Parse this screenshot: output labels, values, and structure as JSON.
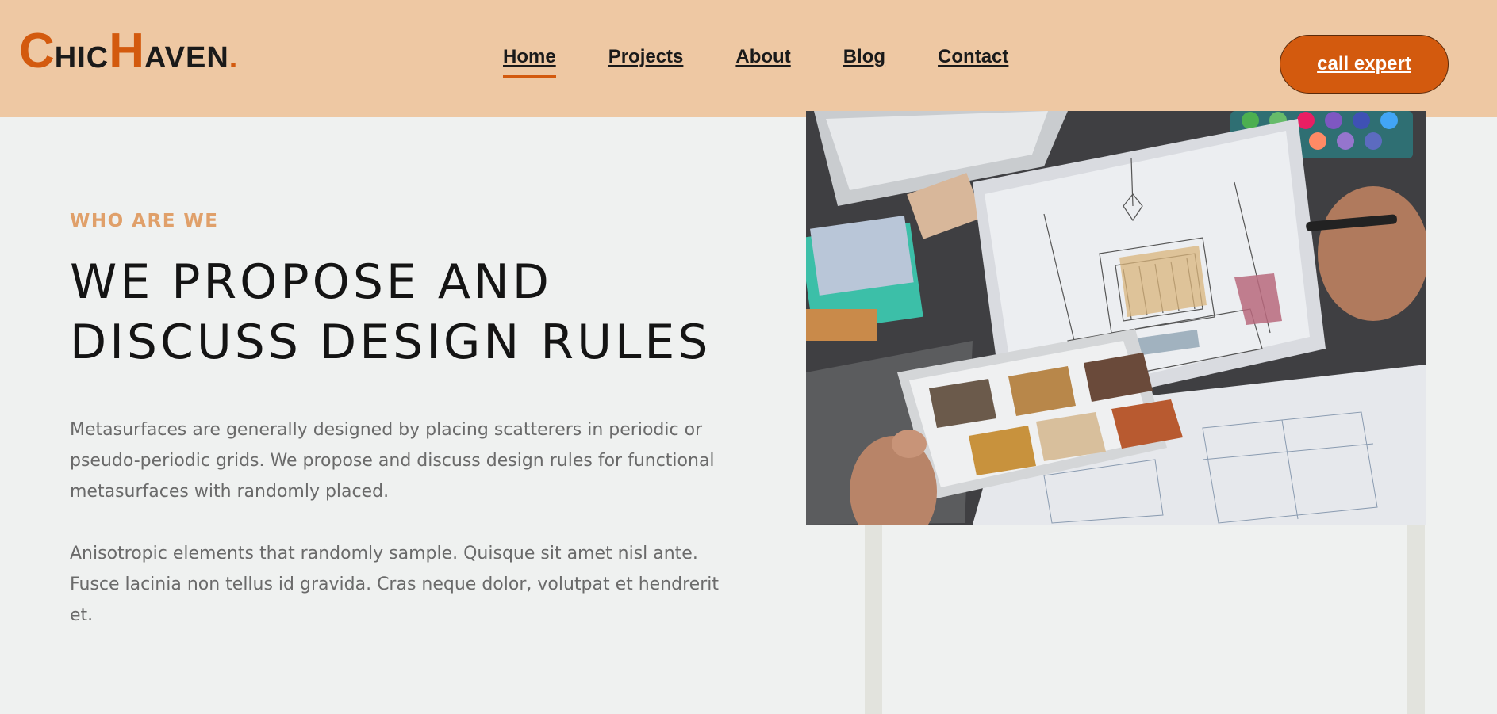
{
  "header": {
    "logo": {
      "c_big": "C",
      "c_rest": "HIC",
      "h_big": "H",
      "h_rest": "AVEN",
      "dot": "."
    },
    "nav": {
      "home": "Home",
      "projects": "Projects",
      "about": "About",
      "blog": "Blog",
      "contact": "Contact"
    },
    "cta_label": "call expert"
  },
  "hero": {
    "eyebrow": "WHO ARE WE",
    "title_line1": "WE PROPOSE AND",
    "title_line2": "DISCUSS DESIGN RULES",
    "paragraph1": "Metasurfaces are generally designed by placing scatterers in periodic or pseudo-periodic grids. We propose and discuss design rules for functional metasurfaces with randomly placed.",
    "paragraph2": "Anisotropic elements that randomly sample. Quisque sit amet nisl ante. Fusce lacinia non tellus id gravida. Cras neque dolor, volutpat et hendrerit et."
  },
  "colors": {
    "header_bg": "#eec8a3",
    "accent": "#d35a0e",
    "page_bg": "#eff1f0",
    "eyebrow": "#e0a06a"
  }
}
